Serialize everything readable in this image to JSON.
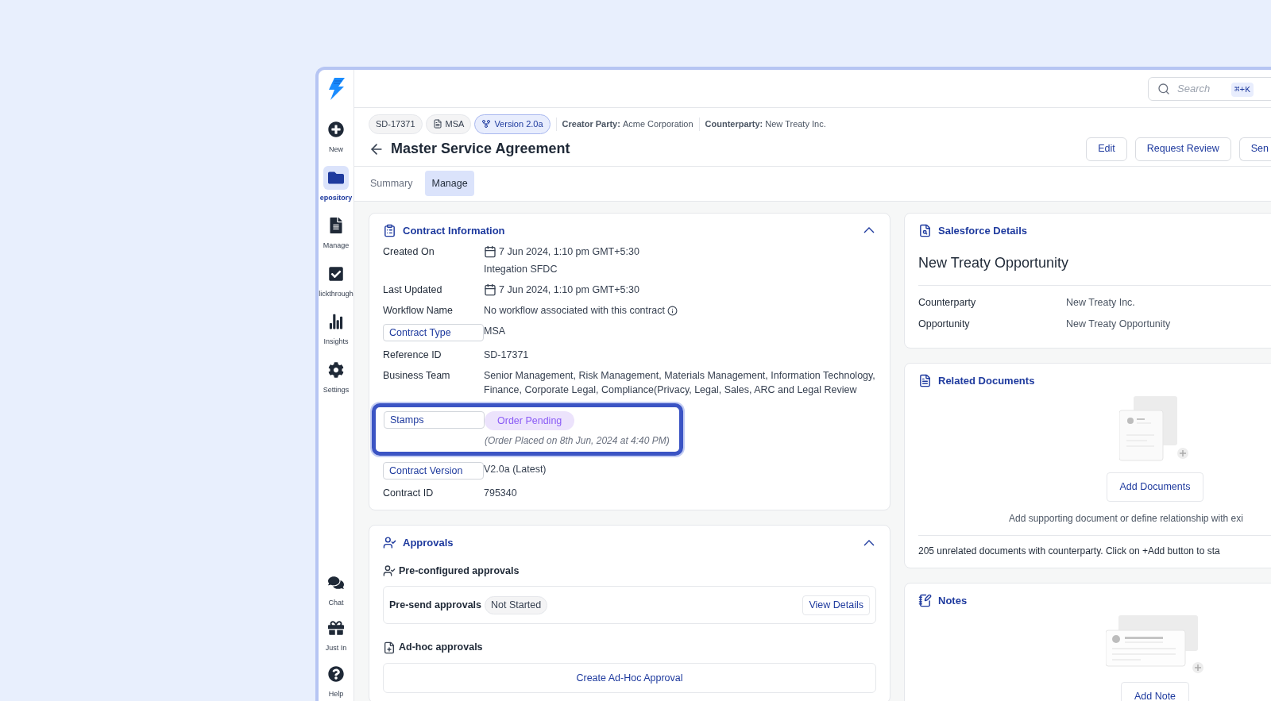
{
  "sidebar": {
    "top_items": [
      {
        "label": "New",
        "selected": false
      },
      {
        "label": "epository",
        "selected": true
      },
      {
        "label": "Manage",
        "selected": false
      },
      {
        "label": "lickthrough",
        "selected": false
      },
      {
        "label": "Insights",
        "selected": false
      },
      {
        "label": "Settings",
        "selected": false
      }
    ],
    "bottom_items": [
      {
        "label": "Chat",
        "selected": false
      },
      {
        "label": "Just In",
        "selected": false
      },
      {
        "label": "Help",
        "selected": false
      }
    ]
  },
  "topbar": {
    "search": {
      "placeholder": "Search",
      "shortcut": "⌘+K"
    }
  },
  "header": {
    "chips": [
      {
        "label": "SD-17371",
        "kind": "plain",
        "selected": false
      },
      {
        "label": "MSA",
        "kind": "doc",
        "selected": false
      },
      {
        "label": "Version 2.0a",
        "kind": "version",
        "selected": true
      }
    ],
    "meta": [
      {
        "label": "Creator Party:",
        "value": "Acme Corporation"
      },
      {
        "label": "Counterparty:",
        "value": "New Treaty Inc."
      }
    ],
    "title": "Master Service Agreement",
    "buttons": [
      "Edit",
      "Request Review",
      "Sen"
    ]
  },
  "tabs": [
    {
      "label": "Summary",
      "selected": false
    },
    {
      "label": "Manage",
      "selected": true
    }
  ],
  "contract_information": {
    "title": "Contract Information",
    "expanded": true,
    "rows": [
      {
        "label": "Created On",
        "boxed": false,
        "kind": "date",
        "value": "7 Jun 2024, 1:10 pm GMT+5:30",
        "sub": "Integation SFDC"
      },
      {
        "label": "Last Updated",
        "boxed": false,
        "kind": "date",
        "value": "7 Jun 2024, 1:10 pm GMT+5:30"
      },
      {
        "label": "Workflow Name",
        "boxed": false,
        "kind": "info",
        "value": "No workflow associated with this contract"
      },
      {
        "label": "Contract Type",
        "boxed": true,
        "kind": "text",
        "value": "MSA"
      },
      {
        "label": "Reference ID",
        "boxed": false,
        "kind": "text",
        "value": "SD-17371"
      },
      {
        "label": "Business Team",
        "boxed": false,
        "kind": "text",
        "value": "Senior Management, Risk Management, Materials Management, Information Technology, Finance, Corporate Legal, Compliance(Privacy, Legal, Sales, ARC and Legal Review"
      },
      {
        "label": "Stamps",
        "boxed": true,
        "kind": "stamp",
        "value": "Order Pending",
        "sub": "(Order Placed on 8th Jun, 2024 at 4:40 PM)",
        "highlighted": true
      },
      {
        "label": "Contract Version",
        "boxed": true,
        "kind": "text",
        "value": "V2.0a (Latest)"
      },
      {
        "label": "Contract ID",
        "boxed": false,
        "kind": "text",
        "value": "795340"
      }
    ]
  },
  "approvals": {
    "title": "Approvals",
    "expanded": true,
    "preconfigured": {
      "title": "Pre-configured approvals",
      "name": "Pre-send approvals",
      "status": "Not Started",
      "button": "View Details"
    },
    "adhoc": {
      "title": "Ad-hoc approvals",
      "button": "Create Ad-Hoc Approval"
    }
  },
  "salesforce_details": {
    "title": "Salesforce Details",
    "heading": "New Treaty Opportunity",
    "rows": [
      {
        "label": "Counterparty",
        "value": "New Treaty Inc."
      },
      {
        "label": "Opportunity",
        "value": "New Treaty Opportunity"
      }
    ]
  },
  "related_documents": {
    "title": "Related Documents",
    "button": "Add Documents",
    "hint": "Add supporting document or define relationship with exi",
    "footer": "205 unrelated documents with counterparty. Click on +Add button to sta"
  },
  "notes": {
    "title": "Notes",
    "button": "Add Note"
  }
}
